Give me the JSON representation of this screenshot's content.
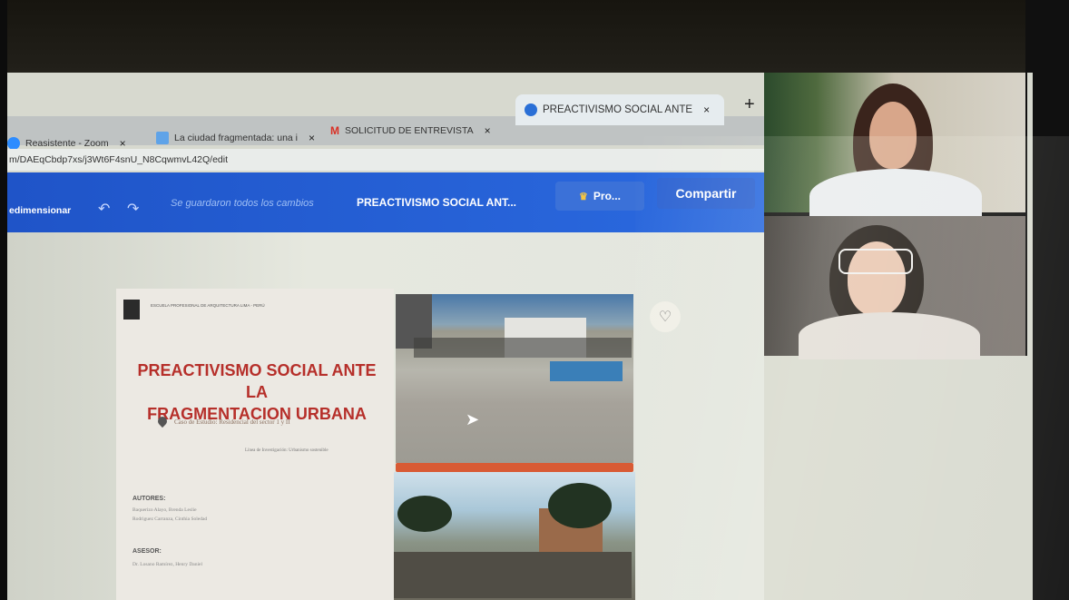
{
  "browser": {
    "tabs": [
      {
        "label": "Reasistente - Zoom",
        "icon": "zoom-icon",
        "active": false
      },
      {
        "label": "La ciudad fragmentada: una i",
        "icon": "scholar-icon",
        "active": false
      },
      {
        "label": "SOLICITUD DE ENTREVISTA",
        "icon": "gmail-icon",
        "active": false
      },
      {
        "label": "PREACTIVISMO SOCIAL ANTE",
        "icon": "canva-icon",
        "active": true
      }
    ],
    "new_tab_label": "+",
    "close_glyph": "×",
    "url": "m/DAEqCbdp7xs/j3Wt6F4snU_N8CqwmvL42Q/edit"
  },
  "editor": {
    "resize_label": "edimensionar",
    "undo_glyph": "↶",
    "redo_glyph": "↷",
    "save_status": "Se guardaron todos los cambios",
    "doc_title": "PREACTIVISMO SOCIAL ANT...",
    "pro_label": "Pro...",
    "pro_icon": "crown-icon",
    "share_label": "Compartir",
    "comment_icon": "comment-plus-icon"
  },
  "slide": {
    "school_text": "ESCUELA PROFESIONAL DE ARQUITECTURA LIMA - PERÚ",
    "title_line1": "PREACTIVISMO SOCIAL ANTE LA",
    "title_line2": "FRAGMENTACION URBANA",
    "case_study": "Caso de Estudio: Residencial del sector 1 y II",
    "research_line": "Línea de Investigación: Urbanismo sostenible",
    "authors_label": "AUTORES:",
    "author1": "Baquerizo Alayo, Brenda Leslie",
    "author2": "Rodriguez Carranza, Cinthia Soledad",
    "advisor_label": "ASESOR:",
    "advisor": "Dr. Losano Ramírez, Henry Daniel"
  },
  "colors": {
    "toolbar": "#2b6ae0",
    "title_red": "#b62f2a",
    "accent_bar": "#d85a34"
  }
}
